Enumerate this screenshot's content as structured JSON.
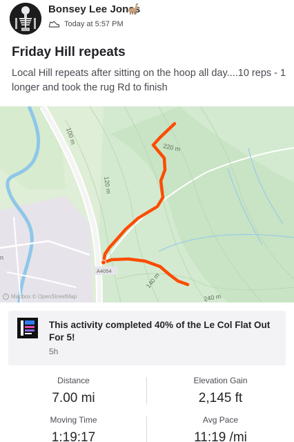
{
  "header": {
    "athlete_name": "Bonsey Lee Jones",
    "name_emoji_icon": "goat-icon",
    "activity_type_icon": "shoe-icon",
    "timestamp": "Today at 5:57 PM"
  },
  "activity": {
    "title": "Friday Hill repeats",
    "description": "Local Hill repeats after sitting on the hoop all day....10 reps - 1 longer and took the rug Rd to finish"
  },
  "map": {
    "contour_labels": [
      "100 m",
      "220 m",
      "120 m",
      "140 m",
      "240 m"
    ],
    "road_label": "A4054",
    "edge_label": "n",
    "attribution": "Mapbox © OpenStreetMap",
    "route_color": "#fc4c02"
  },
  "challenge": {
    "text": "This activity completed 40% of the Le Col Flat Out For 5!",
    "age": "5h"
  },
  "stats": {
    "distance_label": "Distance",
    "distance_value": "7.00 mi",
    "elevation_label": "Elevation Gain",
    "elevation_value": "2,145 ft",
    "moving_time_label": "Moving Time",
    "moving_time_value": "1:19:17",
    "pace_label": "Avg Pace",
    "pace_value": "11:19 /mi"
  }
}
